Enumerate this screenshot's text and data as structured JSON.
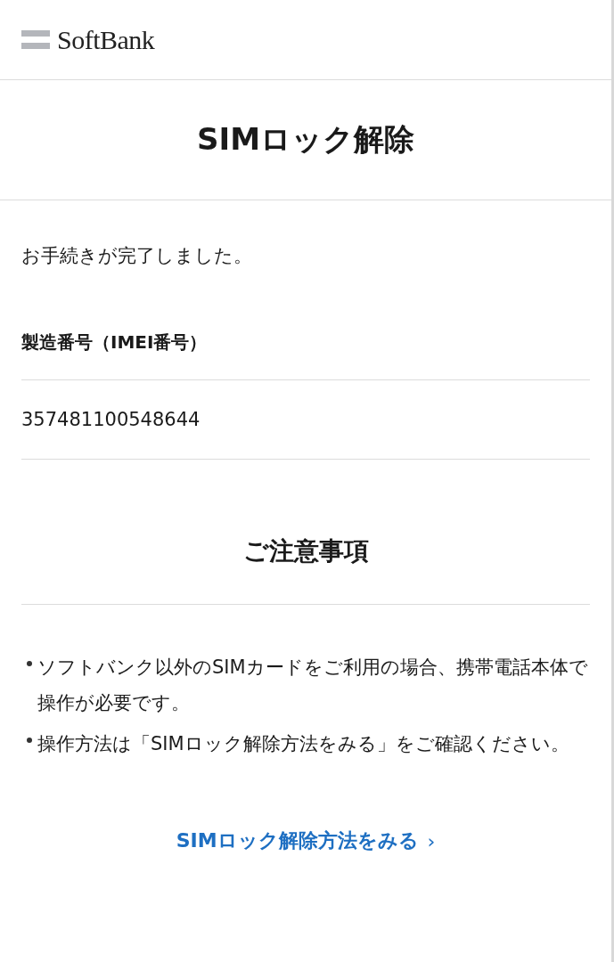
{
  "header": {
    "logo_text": "SoftBank"
  },
  "page_title": "SIMロック解除",
  "message": "お手続きが完了しました。",
  "imei": {
    "label": "製造番号（IMEI番号）",
    "value": "357481100548644"
  },
  "notes": {
    "title": "ご注意事項",
    "items": [
      "ソフトバンク以外のSIMカードをご利用の場合、携帯電話本体で操作が必要です。",
      "操作方法は「SIMロック解除方法をみる」をご確認ください。"
    ]
  },
  "link": {
    "label": "SIMロック解除方法をみる",
    "chevron": "›"
  }
}
